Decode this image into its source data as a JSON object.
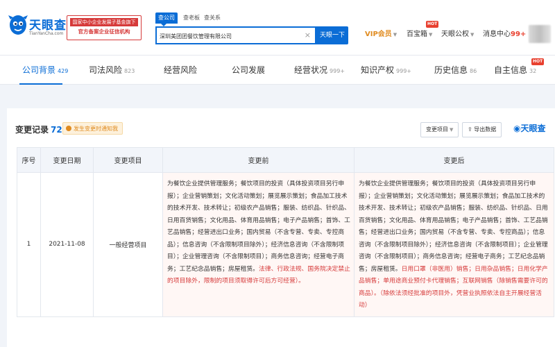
{
  "header": {
    "logo_cn": "天眼查",
    "logo_en": "TianYanCha.com",
    "gov_line1": "国家中小企业发展子基金旗下",
    "gov_line2": "官方备案企业征信机构",
    "search_tabs": [
      "查公司",
      "查老板",
      "查关系"
    ],
    "search_value": "深圳美团团餐饮管理有限公司",
    "search_button": "天眼一下",
    "nav": {
      "vip": "VIP会员",
      "app": "百宝箱",
      "cloud": "天眼公权",
      "msg": "消息中心",
      "msg_count": "99+",
      "hot": "HOT"
    }
  },
  "tabs": [
    {
      "label": "公司背景",
      "count": "429"
    },
    {
      "label": "司法风险",
      "count": "823"
    },
    {
      "label": "经营风险",
      "count": ""
    },
    {
      "label": "公司发展",
      "count": ""
    },
    {
      "label": "经营状况",
      "count": "999+"
    },
    {
      "label": "知识产权",
      "count": "999+"
    },
    {
      "label": "历史信息",
      "count": "86"
    },
    {
      "label": "自主信息",
      "count": "32"
    }
  ],
  "records": {
    "title": "变更记录",
    "count": "72",
    "notice": "发生变更时通知我",
    "filter_button": "变更项目",
    "export_button": "导出数据",
    "brand": "天眼查",
    "columns": [
      "序号",
      "变更日期",
      "变更项目",
      "变更前",
      "变更后"
    ],
    "rows": [
      {
        "index": "1",
        "date": "2021-11-08",
        "item": "一般经营项目",
        "before_normal": "为餐饮企业提供管理服务；餐饮项目的投资（具体投资项目另行申报）；企业营销策划；文化活动策划；展览展示策划；食品加工技术的技术开发、技术转让；初级农产品销售；服装、纺织品、针织品、日用百货销售；文化用品、体育用品销售；电子产品销售；首饰、工艺品销售；经营进出口业务；国内贸易（不含专营、专卖、专控商品）；信息咨询（不含限制项目除外）；经济信息咨询（不含限制项目）；企业管理咨询（不含限制项目）；商务信息咨询；经营电子商务；工艺纪念品销售；房屋租赁。",
        "before_red": "法律、行政法规、国务院决定禁止的项目除外，限制的项目须取得许可后方可经营）。",
        "after_normal_1": "为餐饮企业提供管理服务；餐饮项目的投资（具体投资项目另行申报）；企业营销策划；文化活动策划；展览展示策划；食品加工技术的技术开发、技术转让；初级农产品销售；服装、纺织品、针织品、日用百货销售；文化用品、体育用品销售；电子产品销售；首饰、工艺品销售；经营进出口业务；国内贸易（不含专营、专卖、专控商品）；信息咨询（不含限制项目除外）；经济信息咨询（不含限制项目）；企业管理咨询（不含限制项目）；商务信息咨询；经营电子商务；工艺纪念品销售；房屋租赁。",
        "after_red": "日用口罩（非医用）销售；日用杂品销售；日用化学产品销售；单用途商业预付卡代理销售；互联网销售（除销售需要许可的商品）",
        "after_normal_2": "。（除依法须经批准的项目外，凭营业执照依法自主开展经营活动）"
      }
    ]
  }
}
